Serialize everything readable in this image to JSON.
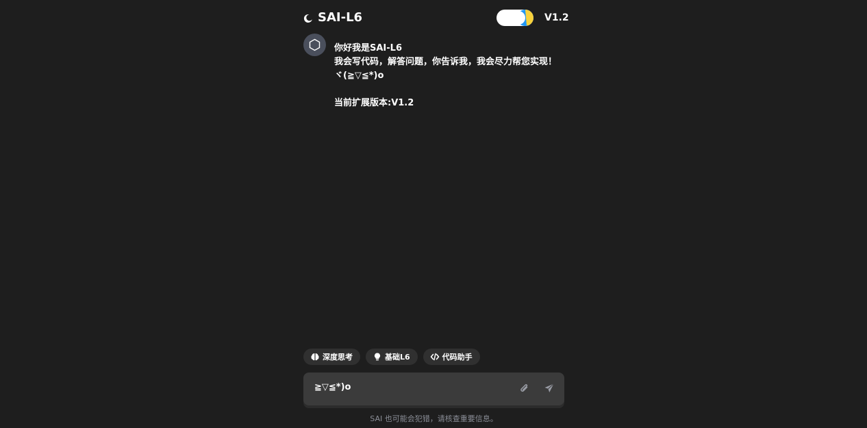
{
  "header": {
    "title": "SAI-L6",
    "version": "V1.2",
    "logo_icon": "crescent-moon-icon",
    "toggle_icon": "theme-toggle-sun-icon",
    "colors": {
      "background": "#1e1e1e",
      "toggle_track": "#ffffff",
      "toggle_blue": "#2196f3",
      "toggle_yellow": "#f7d13b"
    }
  },
  "message": {
    "avatar_icon": "hexagon-icon",
    "greeting": "你好我是SAI-L6",
    "intro": "我会写代码，解答问题，你告诉我，我会尽力帮您实现！ ヾ(≧▽≦*)o",
    "version_line": "当前扩展版本:V1.2"
  },
  "chips": [
    {
      "label": "深度思考",
      "icon": "brain-icon"
    },
    {
      "label": "基础L6",
      "icon": "lightbulb-icon"
    },
    {
      "label": "代码助手",
      "icon": "code-icon"
    }
  ],
  "input": {
    "value": "≧▽≦*)o",
    "attach_icon": "paperclip-icon",
    "send_icon": "send-icon"
  },
  "footer": {
    "disclaimer": "SAI 也可能会犯错，请核查重要信息。"
  }
}
